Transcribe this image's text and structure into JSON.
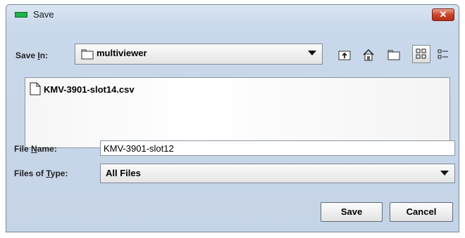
{
  "window": {
    "title": "Save",
    "close_label": "✕"
  },
  "save_in": {
    "label_pre": "Save ",
    "label_key": "I",
    "label_post": "n:",
    "value": "multiviewer"
  },
  "toolbar": {
    "icons": [
      "up-folder-icon",
      "home-icon",
      "new-folder-icon",
      "list-view-icon",
      "details-view-icon"
    ]
  },
  "file_list": {
    "items": [
      {
        "name": "KMV-3901-slot14.csv",
        "icon": "file-icon"
      }
    ]
  },
  "file_name": {
    "label_pre": "File ",
    "label_key": "N",
    "label_post": "ame:",
    "value": "KMV-3901-slot12"
  },
  "file_type": {
    "label_pre": "Files of ",
    "label_key": "T",
    "label_post": "ype:",
    "value": "All Files"
  },
  "buttons": {
    "save": "Save",
    "cancel": "Cancel"
  },
  "colors": {
    "accent_close": "#c9452b",
    "app_icon": "#22b14c"
  }
}
